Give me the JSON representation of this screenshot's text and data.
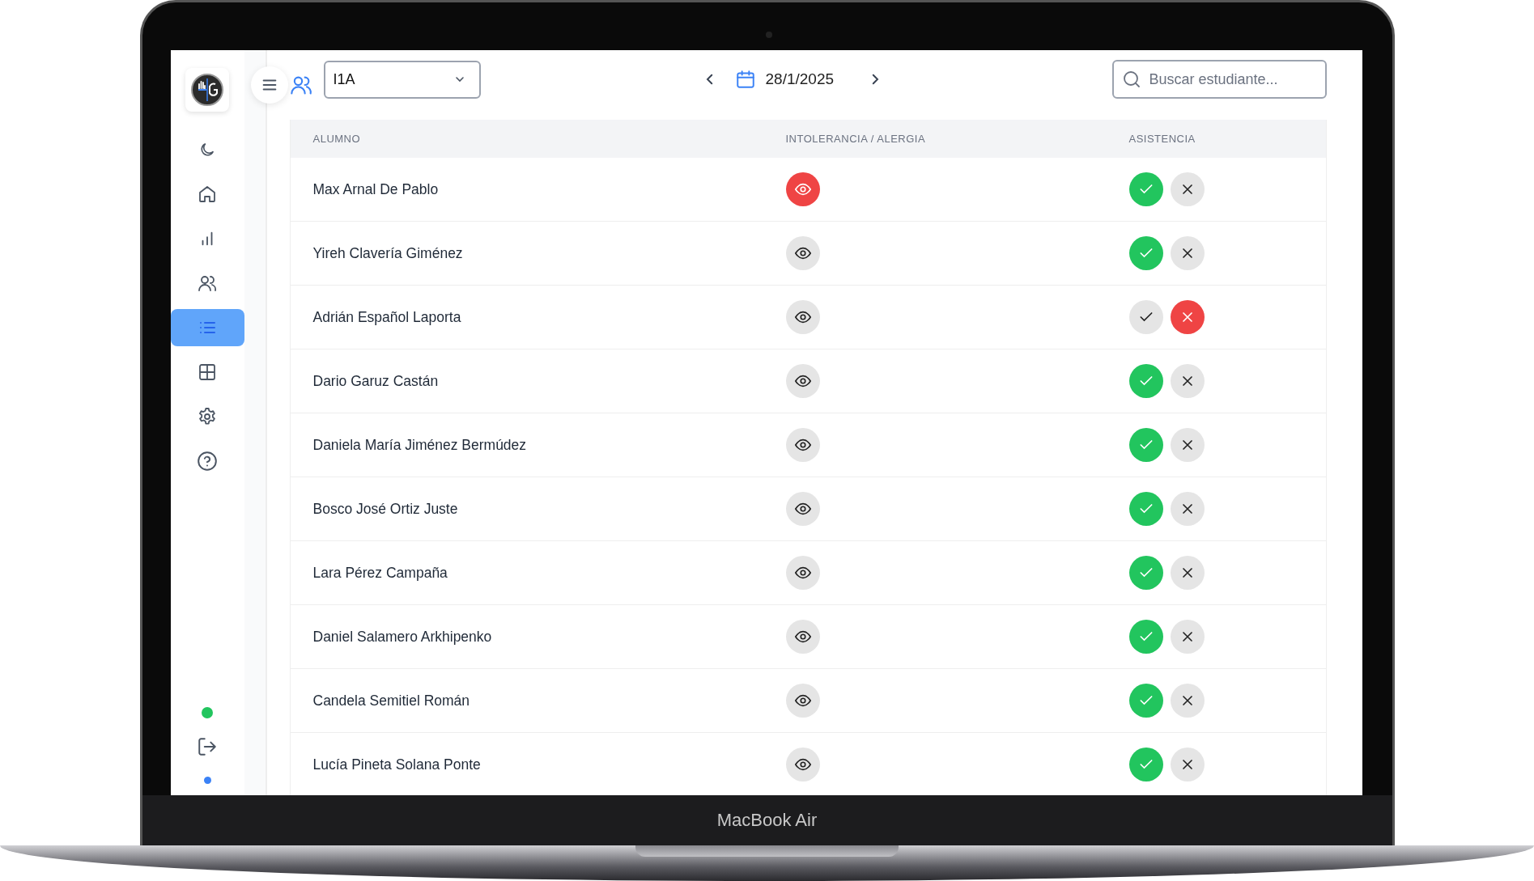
{
  "device": {
    "label": "MacBook Air"
  },
  "sidebar": {
    "items": [
      {
        "kind": "moon",
        "selected": false
      },
      {
        "kind": "home",
        "selected": false
      },
      {
        "kind": "chart",
        "selected": false
      },
      {
        "kind": "users",
        "selected": false
      },
      {
        "kind": "list",
        "selected": true
      },
      {
        "kind": "grid",
        "selected": false
      },
      {
        "kind": "gear",
        "selected": false
      },
      {
        "kind": "help",
        "selected": false
      }
    ],
    "status_dot": {
      "color": "#22c55e"
    },
    "bottom_dot": {
      "color": "#3b82f6"
    }
  },
  "toolbar": {
    "group": "I1A",
    "date": "28/1/2025",
    "search": {
      "placeholder": "Buscar estudiante..."
    }
  },
  "table": {
    "columns": [
      "ALUMNO",
      "INTOLERANCIA / ALERGIA",
      "ASISTENCIA"
    ],
    "rows": [
      {
        "name": "Max Arnal De Pablo",
        "alert": true,
        "present": true
      },
      {
        "name": "Yireh Clavería Giménez",
        "alert": false,
        "present": true
      },
      {
        "name": "Adrián Español Laporta",
        "alert": false,
        "present": false
      },
      {
        "name": "Dario Garuz Castán",
        "alert": false,
        "present": true
      },
      {
        "name": "Daniela María Jiménez Bermúdez",
        "alert": false,
        "present": true
      },
      {
        "name": "Bosco José Ortiz Juste",
        "alert": false,
        "present": true
      },
      {
        "name": "Lara Pérez Campaña",
        "alert": false,
        "present": true
      },
      {
        "name": "Daniel Salamero Arkhipenko",
        "alert": false,
        "present": true
      },
      {
        "name": "Candela Semitiel Román",
        "alert": false,
        "present": true
      },
      {
        "name": "Lucía Pineta Solana Ponte",
        "alert": false,
        "present": true
      }
    ]
  }
}
